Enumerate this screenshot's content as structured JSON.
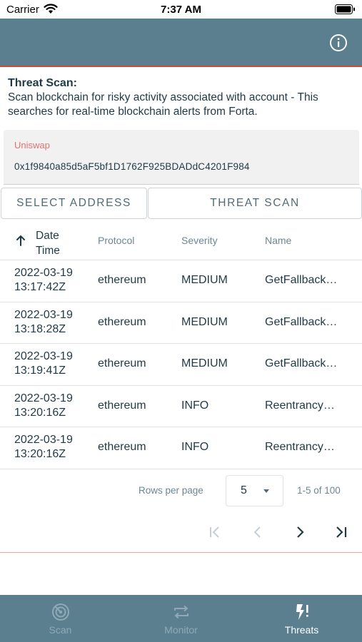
{
  "status_bar": {
    "carrier": "Carrier",
    "time": "7:37 AM"
  },
  "header": {
    "info_icon": "info-icon",
    "accent_color": "#5b7f8e",
    "underline_color": "#d2453a"
  },
  "intro": {
    "title": "Threat Scan:",
    "description": "Scan blockchain for risky activity associated with account - This searches for real-time blockchain alerts from Forta."
  },
  "address": {
    "label": "Uniswap",
    "value": "0x1f9840a85d5aF5bf1D1762F925BDADdC4201F984"
  },
  "buttons": {
    "select_address": "SELECT ADDRESS",
    "threat_scan": "THREAT SCAN"
  },
  "table": {
    "headers": {
      "date_line1": "Date",
      "date_line2": "Time",
      "protocol": "Protocol",
      "severity": "Severity",
      "name": "Name"
    },
    "rows": [
      {
        "date": "2022-03-19",
        "time": "13:17:42Z",
        "protocol": "ethereum",
        "severity": "MEDIUM",
        "name": "GetFallback…"
      },
      {
        "date": "2022-03-19",
        "time": "13:18:28Z",
        "protocol": "ethereum",
        "severity": "MEDIUM",
        "name": "GetFallback…"
      },
      {
        "date": "2022-03-19",
        "time": "13:19:41Z",
        "protocol": "ethereum",
        "severity": "MEDIUM",
        "name": "GetFallback…"
      },
      {
        "date": "2022-03-19",
        "time": "13:20:16Z",
        "protocol": "ethereum",
        "severity": "INFO",
        "name": "Reentrancy…"
      },
      {
        "date": "2022-03-19",
        "time": "13:20:16Z",
        "protocol": "ethereum",
        "severity": "INFO",
        "name": "Reentrancy…"
      }
    ]
  },
  "pagination": {
    "rows_per_page_label": "Rows per page",
    "rows_per_page": "5",
    "range": "1-5 of 100"
  },
  "tabs": [
    {
      "label": "Scan",
      "icon": "radar-icon"
    },
    {
      "label": "Monitor",
      "icon": "repeat-icon"
    },
    {
      "label": "Threats",
      "icon": "bolt-alert-icon",
      "active": true
    }
  ]
}
